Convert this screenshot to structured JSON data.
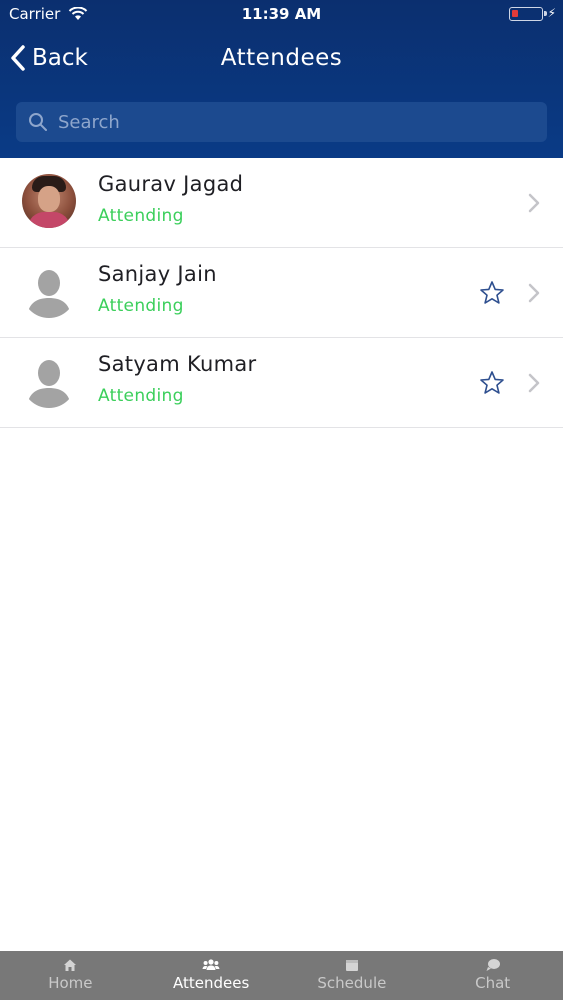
{
  "status_bar": {
    "carrier": "Carrier",
    "time": "11:39 AM"
  },
  "nav": {
    "back_label": "Back",
    "title": "Attendees"
  },
  "search": {
    "placeholder": "Search"
  },
  "attendees": [
    {
      "name": "Gaurav Jagad",
      "status": "Attending",
      "avatar": "photo",
      "starred_visible": false
    },
    {
      "name": "Sanjay Jain",
      "status": "Attending",
      "avatar": "placeholder",
      "starred_visible": true
    },
    {
      "name": "Satyam Kumar",
      "status": "Attending",
      "avatar": "placeholder",
      "starred_visible": true
    }
  ],
  "tabs": [
    {
      "label": "Home",
      "icon": "home-icon",
      "active": false
    },
    {
      "label": "Attendees",
      "icon": "people-icon",
      "active": true
    },
    {
      "label": "Schedule",
      "icon": "calendar-icon",
      "active": false
    },
    {
      "label": "Chat",
      "icon": "chat-icon",
      "active": false
    }
  ],
  "colors": {
    "header": "#0a3b86",
    "status_text": "#3bcf5b",
    "star": "#2e4f8f",
    "tabbar": "#787878"
  }
}
